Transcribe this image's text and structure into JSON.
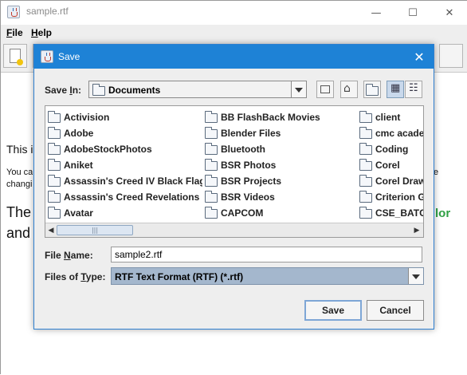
{
  "main_window": {
    "title": "sample.rtf",
    "minimize_glyph": "—",
    "maximize_glyph": "☐",
    "close_glyph": "✕",
    "menu": [
      {
        "label_pre": "",
        "mnemonic": "F",
        "label_post": "ile"
      },
      {
        "label_pre": "",
        "mnemonic": "H",
        "label_post": "elp"
      }
    ],
    "editor_lines": [
      {
        "text": "This i",
        "right": ""
      },
      {
        "text": "You ca",
        "right": "e"
      },
      {
        "text": "changi",
        "right": ""
      },
      {
        "text": "The",
        "right": "lor"
      },
      {
        "text": "and",
        "right": ""
      }
    ],
    "editor_colors": {
      "green": "#2ea043"
    }
  },
  "dialog": {
    "title": "Save",
    "close_glyph": "✕",
    "save_in_label": {
      "pre": "Save ",
      "mnemonic": "I",
      "post": "n:"
    },
    "save_in_value": "Documents",
    "nav_buttons": [
      {
        "name": "up-one-level-icon",
        "glyph": "⬏",
        "active": false
      },
      {
        "name": "home-icon",
        "glyph": "⌂",
        "active": false
      },
      {
        "name": "new-folder-icon",
        "glyph": "▭",
        "active": false
      },
      {
        "name": "list-view-icon",
        "glyph": "▦",
        "active": true
      },
      {
        "name": "details-view-icon",
        "glyph": "☷",
        "active": false
      }
    ],
    "files": {
      "col1": [
        "Activision",
        "Adobe",
        "AdobeStockPhotos",
        "Aniket",
        "Assassin's Creed IV Black Flag",
        "Assassin's Creed Revelations",
        "Avatar"
      ],
      "col2": [
        "BB FlashBack Movies",
        "Blender Files",
        "Bluetooth",
        "BSR Photos",
        "BSR Projects",
        "BSR Videos",
        "CAPCOM"
      ],
      "col3": [
        "client",
        "cmc acade",
        "Coding",
        "Corel",
        "Corel Draw",
        "Criterion G",
        "CSE_BATC"
      ]
    },
    "scroll": {
      "left_arrow": "◀",
      "right_arrow": "▶",
      "thumb_grip": "|||"
    },
    "file_name_label": {
      "pre": "File ",
      "mnemonic": "N",
      "post": "ame:"
    },
    "file_name_value": "sample2.rtf",
    "file_type_label": {
      "pre": "Files of ",
      "mnemonic": "T",
      "post": "ype:"
    },
    "file_type_value": "RTF Text Format (RTF) (*.rtf)",
    "save_button": "Save",
    "cancel_button": "Cancel"
  },
  "colors": {
    "dialog_titlebar": "#1e82d6",
    "selected_type_bg": "#a4b7cd"
  }
}
